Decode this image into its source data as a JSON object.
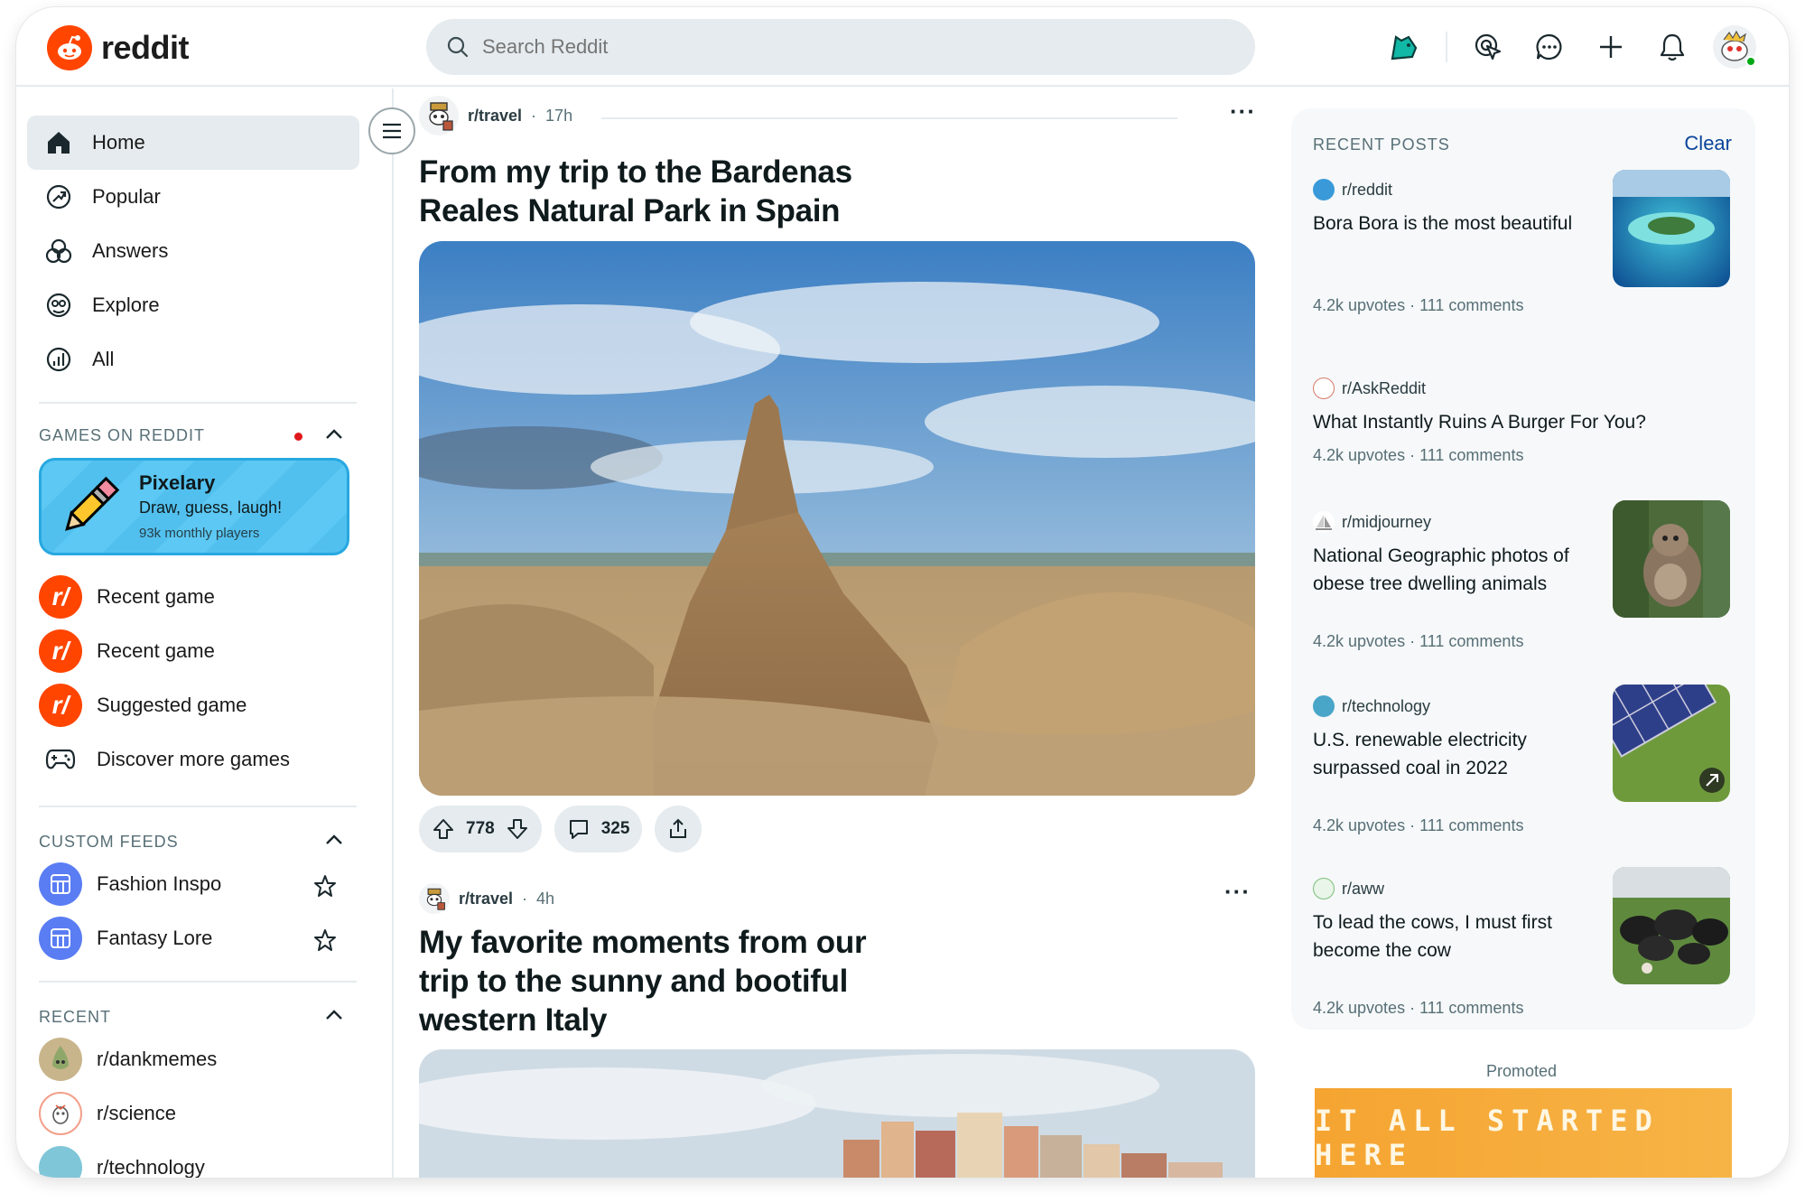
{
  "header": {
    "logo_text": "reddit",
    "search_placeholder": "Search Reddit",
    "icons": [
      "ads-icon",
      "popular-icon",
      "chat-icon",
      "create-icon",
      "notification-icon",
      "user-avatar"
    ]
  },
  "sidebar": {
    "nav": [
      {
        "label": "Home",
        "icon": "home-icon",
        "active": true
      },
      {
        "label": "Popular",
        "icon": "popular-icon"
      },
      {
        "label": "Answers",
        "icon": "answers-icon"
      },
      {
        "label": "Explore",
        "icon": "explore-icon"
      },
      {
        "label": "All",
        "icon": "all-icon"
      }
    ],
    "games_header": "GAMES ON REDDIT",
    "featured_game": {
      "title": "Pixelary",
      "tagline": "Draw, guess, laugh!",
      "players": "93k monthly players"
    },
    "games": [
      {
        "label": "Recent game"
      },
      {
        "label": "Recent game"
      },
      {
        "label": "Suggested game"
      },
      {
        "label": "Discover more games"
      }
    ],
    "custom_feeds_header": "CUSTOM FEEDS",
    "custom_feeds": [
      {
        "label": "Fashion Inspo"
      },
      {
        "label": "Fantasy Lore"
      }
    ],
    "recent_header": "RECENT",
    "recent": [
      {
        "label": "r/dankmemes"
      },
      {
        "label": "r/science"
      },
      {
        "label": "r/technology"
      }
    ]
  },
  "feed": {
    "posts": [
      {
        "subreddit": "r/travel",
        "age": "17h",
        "title_lines": [
          "From my trip to the Bardenas",
          "Reales Natural Park in Spain"
        ],
        "upvotes": "778",
        "comments": "325"
      },
      {
        "subreddit": "r/travel",
        "age": "4h",
        "title_lines": [
          "My favorite moments from our",
          "trip to the sunny and bootiful",
          "western Italy"
        ]
      }
    ]
  },
  "rail": {
    "header": "RECENT POSTS",
    "clear_label": "Clear",
    "posts": [
      {
        "subreddit": "r/reddit",
        "title_lines": [
          "Bora Bora is the most beautiful"
        ],
        "stats": "4.2k upvotes · 111 comments",
        "thumb": "island"
      },
      {
        "subreddit": "r/AskReddit",
        "title_lines": [
          "What Instantly Ruins A Burger For You?"
        ],
        "stats": "4.2k upvotes · 111 comments"
      },
      {
        "subreddit": "r/midjourney",
        "title_lines": [
          "National Geographic photos of",
          "obese tree dwelling animals"
        ],
        "stats": "4.2k upvotes · 111 comments",
        "thumb": "sloth"
      },
      {
        "subreddit": "r/technology",
        "title_lines": [
          "U.S. renewable electricity",
          "surpassed coal in 2022"
        ],
        "stats": "4.2k upvotes · 111 comments",
        "thumb": "solar"
      },
      {
        "subreddit": "r/aww",
        "title_lines": [
          "To lead the cows, I must first",
          "become the cow"
        ],
        "stats": "4.2k upvotes · 111 comments",
        "thumb": "cows"
      }
    ],
    "promoted_label": "Promoted",
    "promo_text": "IT ALL STARTED HERE"
  },
  "colors": {
    "brand": "#ff4500",
    "accent_link": "#0a449b",
    "nav_active": "#e5ebee",
    "online": "#01a816"
  }
}
